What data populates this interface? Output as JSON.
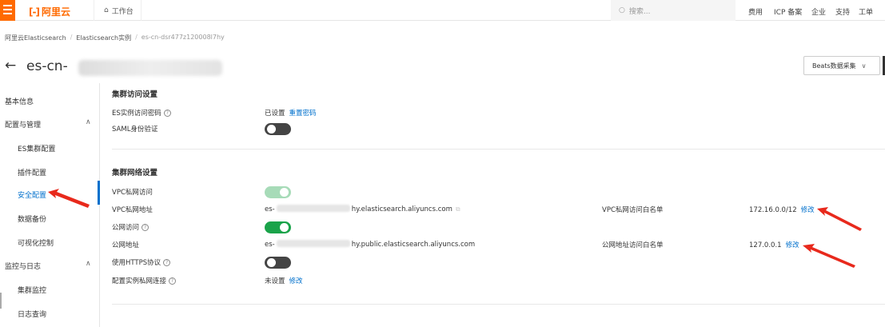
{
  "topbar": {
    "logo_mark": "[-]",
    "logo_text": "阿里云",
    "workbench_label": "工作台",
    "search_placeholder": "搜索...",
    "nav": [
      "费用",
      "ICP 备案",
      "企业",
      "支持",
      "工单"
    ]
  },
  "breadcrumb": [
    "阿里云Elasticsearch",
    "Elasticsearch实例",
    "es-cn-dsr477z120008l7hy"
  ],
  "header": {
    "title_prefix": "es-cn-",
    "beats_button": "Beats数据采集"
  },
  "sidebar": {
    "items": [
      {
        "label": "基本信息"
      },
      {
        "label": "配置与管理"
      },
      {
        "label": "ES集群配置"
      },
      {
        "label": "插件配置"
      },
      {
        "label": "安全配置"
      },
      {
        "label": "数据备份"
      },
      {
        "label": "可视化控制"
      },
      {
        "label": "监控与日志"
      },
      {
        "label": "集群监控"
      },
      {
        "label": "日志查询"
      }
    ]
  },
  "access": {
    "title": "集群访问设置",
    "password_label": "ES实例访问密码",
    "password_status": "已设置",
    "reset_link": "重置密码",
    "saml_label": "SAML身份验证",
    "saml_enabled": false
  },
  "network": {
    "title": "集群网络设置",
    "vpc_access_label": "VPC私网访问",
    "vpc_access_enabled": true,
    "vpc_addr_label": "VPC私网地址",
    "vpc_addr_prefix": "es-",
    "vpc_addr_suffix": "hy.elasticsearch.aliyuncs.com",
    "vpc_whitelist_label": "VPC私网访问白名单",
    "vpc_whitelist_value": "172.16.0.0/12",
    "vpc_whitelist_edit": "修改",
    "public_access_label": "公网访问",
    "public_access_enabled": true,
    "public_addr_label": "公网地址",
    "public_addr_prefix": "es-",
    "public_addr_suffix": "hy.public.elasticsearch.aliyuncs.com",
    "public_whitelist_label": "公网地址访问白名单",
    "public_whitelist_value": "127.0.0.1",
    "public_whitelist_edit": "修改",
    "https_label": "使用HTTPS协议",
    "https_enabled": false,
    "private_link_label": "配置实例私网连接",
    "private_link_status": "未设置",
    "private_link_edit": "修改"
  },
  "colors": {
    "brand": "#ff6a00",
    "link": "#0070cc",
    "toggle_on": "#1aa34a",
    "annotation_arrow": "#e8291c"
  }
}
